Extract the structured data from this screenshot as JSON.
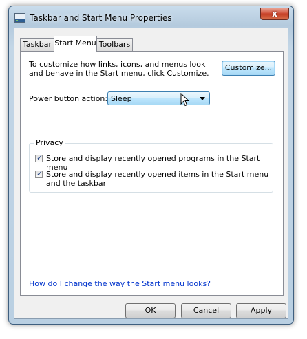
{
  "window": {
    "title": "Taskbar and Start Menu Properties",
    "close_glyph": "x",
    "icons": {
      "app": "taskbar-properties-icon",
      "close": "close-icon"
    }
  },
  "tabs": [
    {
      "label": "Taskbar",
      "active": false
    },
    {
      "label": "Start Menu",
      "active": true
    },
    {
      "label": "Toolbars",
      "active": false
    }
  ],
  "start_menu": {
    "description": "To customize how links, icons, and menus look and behave in the Start menu, click Customize.",
    "customize_button": "Customize...",
    "power_button_label": "Power button action:",
    "power_button_value": "Sleep",
    "privacy": {
      "title": "Privacy",
      "items": [
        {
          "label": "Store and display recently opened programs in the Start menu",
          "checked": true
        },
        {
          "label": "Store and display recently opened items in the Start menu and the taskbar",
          "checked": true
        }
      ]
    },
    "help_link": "How do I change the way the Start menu looks?"
  },
  "footer": {
    "ok": "OK",
    "cancel": "Cancel",
    "apply": "Apply"
  },
  "colors": {
    "link": "#0033cc",
    "close_button": "#c33b22",
    "focus_blue": "#3c7fb1"
  },
  "check_glyph": "✓"
}
